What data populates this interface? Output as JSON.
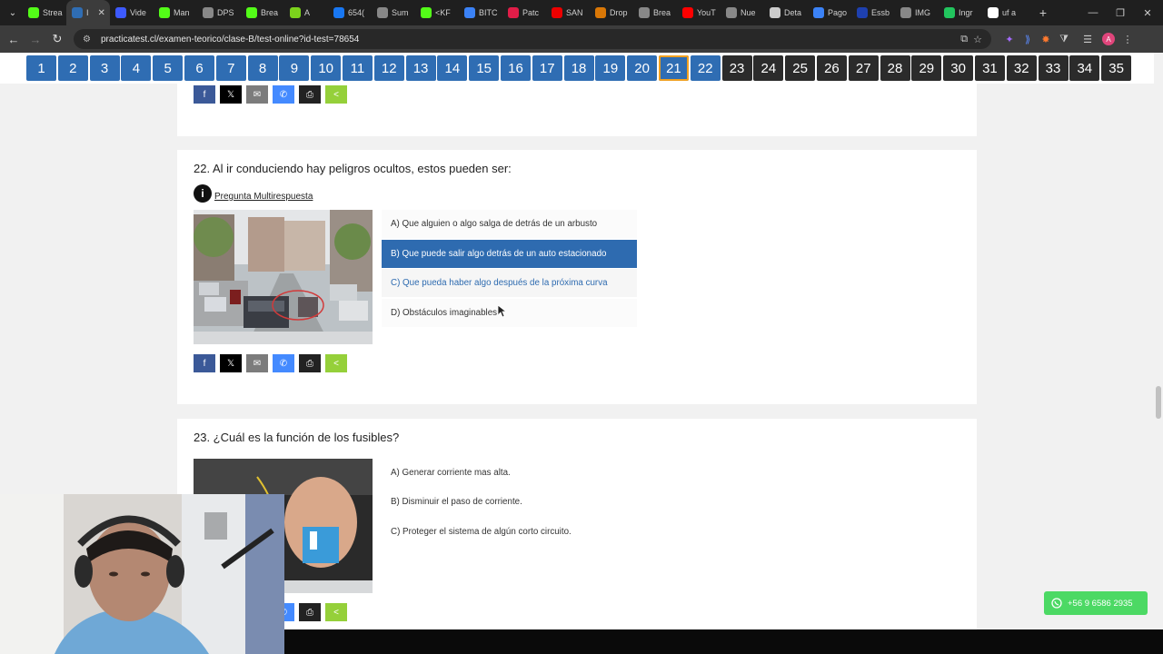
{
  "browser": {
    "tabs": [
      {
        "label": "Strea",
        "icon": "kick-icon",
        "color": "#53fc18"
      },
      {
        "label": "I",
        "icon": "practicatest-icon",
        "color": "#2f6db3",
        "active": true
      },
      {
        "label": "Vide",
        "icon": "video-icon",
        "color": "#3d5afe"
      },
      {
        "label": "Man",
        "icon": "kick-icon",
        "color": "#53fc18"
      },
      {
        "label": "DPS",
        "icon": "globe-icon",
        "color": "#888888"
      },
      {
        "label": "Brea",
        "icon": "kick-icon",
        "color": "#53fc18"
      },
      {
        "label": "A",
        "icon": "pen-icon",
        "color": "#7cd31c"
      },
      {
        "label": "654(",
        "icon": "facebook-icon",
        "color": "#1877f2"
      },
      {
        "label": "Sum",
        "icon": "globe-icon",
        "color": "#888888"
      },
      {
        "label": "<KF",
        "icon": "kick-icon",
        "color": "#53fc18"
      },
      {
        "label": "BITC",
        "icon": "app-icon",
        "color": "#3b82f6"
      },
      {
        "label": "Patc",
        "icon": "patreon-icon",
        "color": "#e11d48"
      },
      {
        "label": "SAN",
        "icon": "santander-icon",
        "color": "#ec0000"
      },
      {
        "label": "Drop",
        "icon": "dropshipping-icon",
        "color": "#d97706"
      },
      {
        "label": "Brea",
        "icon": "globe-icon",
        "color": "#888888"
      },
      {
        "label": "YouT",
        "icon": "youtube-icon",
        "color": "#ff0000"
      },
      {
        "label": "Nue",
        "icon": "globe-icon",
        "color": "#888888"
      },
      {
        "label": "Deta",
        "icon": "wikipedia-icon",
        "color": "#cccccc"
      },
      {
        "label": "Pago",
        "icon": "pago-icon",
        "color": "#3b82f6"
      },
      {
        "label": "Essb",
        "icon": "essbio-icon",
        "color": "#1e40af"
      },
      {
        "label": "IMG",
        "icon": "globe-icon",
        "color": "#888888"
      },
      {
        "label": "Ingr",
        "icon": "sheet-icon",
        "color": "#22c55e"
      },
      {
        "label": "uf a",
        "icon": "google-icon",
        "color": "#ffffff"
      }
    ],
    "url": "practicatest.cl/examen-teorico/clase-B/test-online?id-test=78654",
    "profile_initial": "A"
  },
  "question_nav": {
    "items": [
      {
        "n": "1",
        "state": "blue"
      },
      {
        "n": "2",
        "state": "blue"
      },
      {
        "n": "3",
        "state": "blue"
      },
      {
        "n": "4",
        "state": "blue"
      },
      {
        "n": "5",
        "state": "blue"
      },
      {
        "n": "6",
        "state": "blue"
      },
      {
        "n": "7",
        "state": "blue"
      },
      {
        "n": "8",
        "state": "blue"
      },
      {
        "n": "9",
        "state": "blue"
      },
      {
        "n": "10",
        "state": "blue"
      },
      {
        "n": "11",
        "state": "blue"
      },
      {
        "n": "12",
        "state": "blue"
      },
      {
        "n": "13",
        "state": "blue"
      },
      {
        "n": "14",
        "state": "blue"
      },
      {
        "n": "15",
        "state": "blue"
      },
      {
        "n": "16",
        "state": "blue"
      },
      {
        "n": "17",
        "state": "blue"
      },
      {
        "n": "18",
        "state": "blue"
      },
      {
        "n": "19",
        "state": "blue"
      },
      {
        "n": "20",
        "state": "blue"
      },
      {
        "n": "21",
        "state": "current"
      },
      {
        "n": "22",
        "state": "blue"
      },
      {
        "n": "23",
        "state": "dark"
      },
      {
        "n": "24",
        "state": "dark"
      },
      {
        "n": "25",
        "state": "dark"
      },
      {
        "n": "26",
        "state": "dark"
      },
      {
        "n": "27",
        "state": "dark"
      },
      {
        "n": "28",
        "state": "dark"
      },
      {
        "n": "29",
        "state": "dark"
      },
      {
        "n": "30",
        "state": "dark"
      },
      {
        "n": "31",
        "state": "dark"
      },
      {
        "n": "32",
        "state": "dark"
      },
      {
        "n": "33",
        "state": "dark"
      },
      {
        "n": "34",
        "state": "dark"
      },
      {
        "n": "35",
        "state": "dark"
      }
    ]
  },
  "share": {
    "facebook": "f",
    "twitter": "𝕏",
    "email": "✉",
    "messenger": "✆",
    "print": "⎙",
    "sharethis": "<"
  },
  "q22": {
    "title": "22. Al ir conduciendo hay peligros ocultos, estos pueden ser:",
    "type_label": "Pregunta Multirespuesta",
    "info_icon": "i",
    "options": [
      "A) Que alguien o algo salga de detrás de un arbusto",
      "B) Que puede salir algo detrás de un auto estacionado",
      "C) Que pueda haber algo después de la próxima curva",
      "D) Obstáculos imaginables."
    ],
    "selected_index": 1
  },
  "q23": {
    "title": "23. ¿Cuál es la función de los fusibles?",
    "options": [
      "A) Generar corriente mas alta.",
      "B) Disminuir el paso de corriente.",
      "C) Proteger el sistema de algún corto circuito."
    ]
  },
  "whatsapp": {
    "label": "+56 9 6586 2935",
    "color": "#4cd964"
  },
  "colors": {
    "primary": "#2f6db3",
    "current_outline": "#f0a020",
    "answered": "#2b2b2b"
  }
}
